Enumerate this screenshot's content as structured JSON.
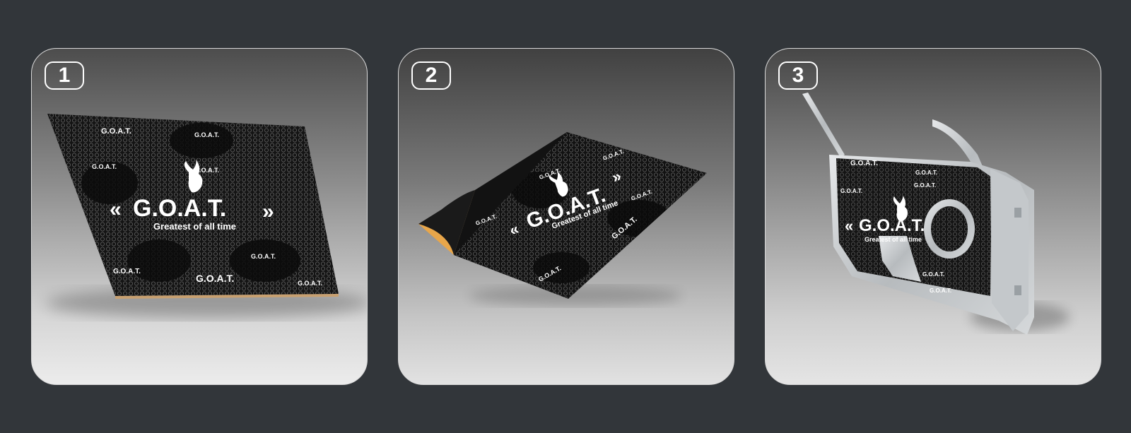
{
  "steps": [
    {
      "number": "1"
    },
    {
      "number": "2"
    },
    {
      "number": "3"
    }
  ],
  "mat": {
    "brand": "G.O.A.T.",
    "tagline": "Greatest of all time",
    "left_marks": "«",
    "right_marks": "»"
  },
  "colors": {
    "page_background": "#32363a",
    "card_border": "#d9d9d9",
    "mat_black": "#111111",
    "adhesive_backing": "#e8a64a",
    "door_metal": "#cfd2d4"
  },
  "icons": [
    "goat-logo-icon"
  ]
}
